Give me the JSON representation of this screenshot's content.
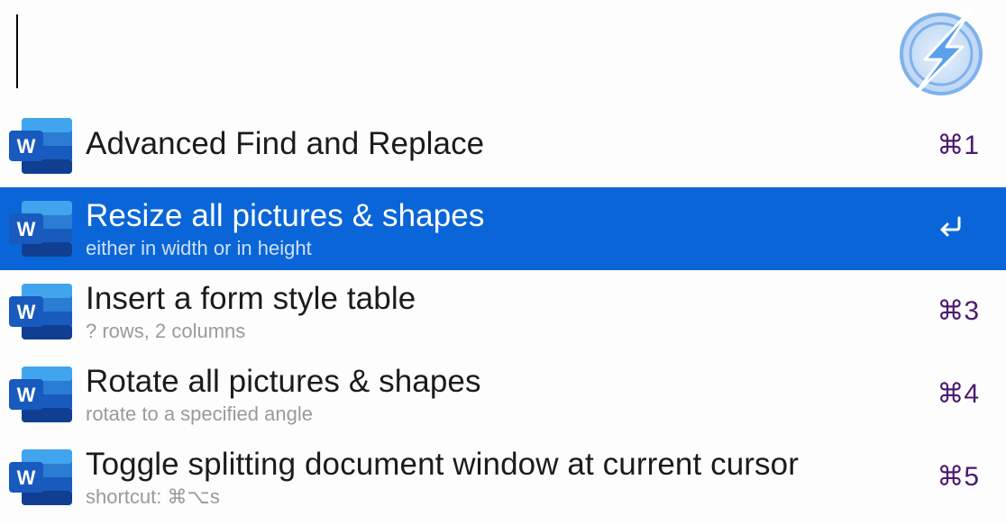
{
  "search": {
    "query": ""
  },
  "app": {
    "logo_icon": "lightning-bolt-icon",
    "accent_color": "#0a66d8",
    "shortcut_color": "#4b1a6e"
  },
  "results": [
    {
      "icon": "word-icon",
      "title": "Advanced Find and Replace",
      "subtitle": "",
      "shortcut": "⌘1",
      "selected": false
    },
    {
      "icon": "word-icon",
      "title": "Resize all pictures & shapes",
      "subtitle": "either in width or in height",
      "shortcut": "",
      "action_icon": "enter-icon",
      "selected": true
    },
    {
      "icon": "word-icon",
      "title": "Insert a form style table",
      "subtitle": "? rows, 2 columns",
      "shortcut": "⌘3",
      "selected": false
    },
    {
      "icon": "word-icon",
      "title": "Rotate all pictures & shapes",
      "subtitle": "rotate to a specified angle",
      "shortcut": "⌘4",
      "selected": false
    },
    {
      "icon": "word-icon",
      "title": "Toggle splitting document window at current cursor",
      "subtitle": "shortcut: ⌘⌥s",
      "shortcut": "⌘5",
      "selected": false
    }
  ]
}
